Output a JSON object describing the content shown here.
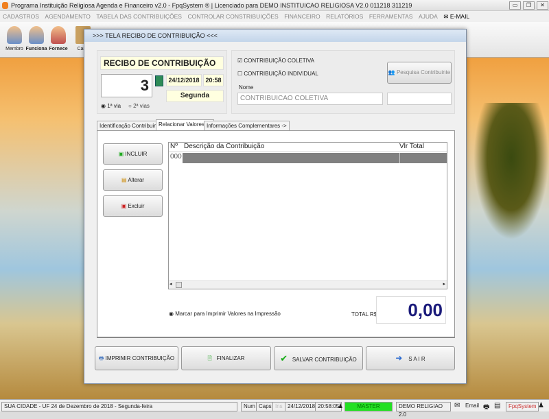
{
  "window": {
    "title": "Programa Instituição Religiosa Agenda e Financeiro v2.0 - FpqSystem ® | Licenciado para  DEMO INSTITUICAO RELIGIOSA V2.0 011218 311219",
    "minimize": "▭",
    "restore": "❐",
    "close": "✕"
  },
  "menu": [
    "CADASTROS",
    "AGENDAMENTO",
    "TABELA DAS CONTRIBUIÇÕES",
    "CONTROLAR CONSTRIBUIÇÕES",
    "FINANCEIRO",
    "RELATÓRIOS",
    "FERRAMENTAS",
    "AJUDA",
    "E-MAIL"
  ],
  "toolbar": [
    "Membro",
    "Funciona",
    "Fornece",
    "Carta"
  ],
  "dialog": {
    "title": ">>>  TELA RECIBO DE CONTRIBUIÇÃO  <<<",
    "receipt_title": "RECIBO DE CONTRIBUIÇÃO",
    "number": "3",
    "date": "24/12/2018",
    "time": "20:58",
    "weekday": "Segunda",
    "via1": "1ª via",
    "via2": "2ª vias",
    "coletiva": "CONTRIBUIÇÃO COLETIVA",
    "individual": "CONTRIBUIÇÃO INDIVIDUAL",
    "nome_label": "Nome",
    "nome_value": "CONTRIBUICAO COLETIVA",
    "extra_value": "",
    "pesquisa": "Pesquisa Contribuinte",
    "tabs": [
      "Identificação Contribuinte ->",
      "Relacionar Valores ->",
      "Informações Complementares ->"
    ],
    "active_tab": 1,
    "incluir": "INCLUIR",
    "alterar": "Alterar",
    "excluir": "Excluir",
    "grid": {
      "columns": [
        "Nº",
        "Descrição da Contribuição",
        "Vlr Total"
      ],
      "rows": [
        [
          "000",
          "",
          ""
        ]
      ]
    },
    "marcar": "Marcar para Imprimir Valores na Impressão",
    "total_label": "TOTAL R$",
    "total": "0,00",
    "buttons": [
      "IMPRIMIR CONTRIBUIÇÃO",
      "FINALIZAR",
      "SALVAR CONTRIBUIÇÃO",
      "S A I R"
    ]
  },
  "status": {
    "city": "SUA CIDADE - UF 24 de Dezembro de 2018 - Segunda-feira",
    "num": "Num",
    "caps": "Caps",
    "ins": "Ins",
    "date": "24/12/2018",
    "time": "20:58:05",
    "user": "MASTER",
    "company": "DEMO RELIGIAO 2.0",
    "email": "Email",
    "brand": "FpqSystem"
  },
  "colors": {
    "total": "#1a1a7a",
    "master": "#22e022",
    "grid_row": "#808080"
  }
}
